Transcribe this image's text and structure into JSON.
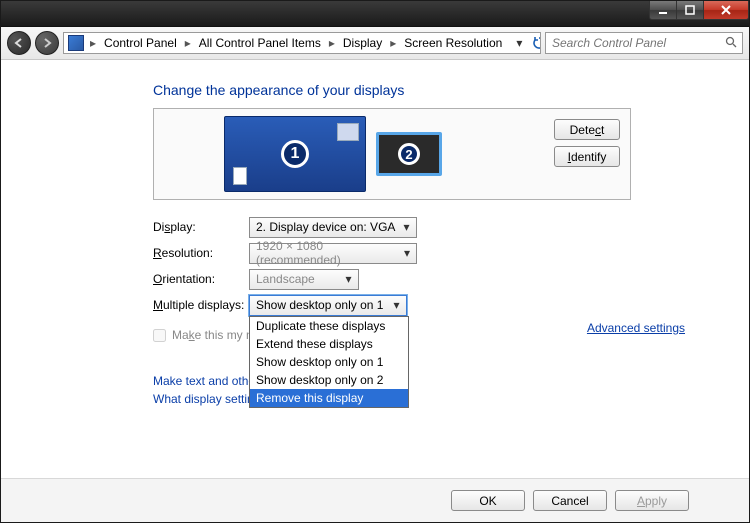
{
  "titlebar": {
    "minimize_tip": "Minimize",
    "maximize_tip": "Maximize",
    "close_tip": "Close"
  },
  "nav": {
    "back_tip": "Back",
    "forward_tip": "Forward",
    "crumbs": [
      "Control Panel",
      "All Control Panel Items",
      "Display",
      "Screen Resolution"
    ],
    "refresh_tip": "Refresh",
    "search_placeholder": "Search Control Panel"
  },
  "heading": "Change the appearance of your displays",
  "preview": {
    "detect_label": "Detect",
    "identify_label": "Identify",
    "monitor1": "1",
    "monitor2": "2"
  },
  "fields": {
    "display_label": "Display:",
    "display_value": "2. Display device on: VGA",
    "resolution_label": "Resolution:",
    "resolution_value": "1920 × 1080 (recommended)",
    "orientation_label": "Orientation:",
    "orientation_value": "Landscape",
    "multiple_label": "Multiple displays:",
    "multiple_value": "Show desktop only on 1",
    "multiple_options": [
      "Duplicate these displays",
      "Extend these displays",
      "Show desktop only on 1",
      "Show desktop only on 2",
      "Remove this display"
    ],
    "multiple_selected_index": 4
  },
  "checkbox_label": "Make this my ma",
  "advanced_label": "Advanced settings",
  "links": {
    "line1": "Make text and othe",
    "line2": "What display settings should I choose?"
  },
  "footer": {
    "ok": "OK",
    "cancel": "Cancel",
    "apply": "Apply"
  }
}
